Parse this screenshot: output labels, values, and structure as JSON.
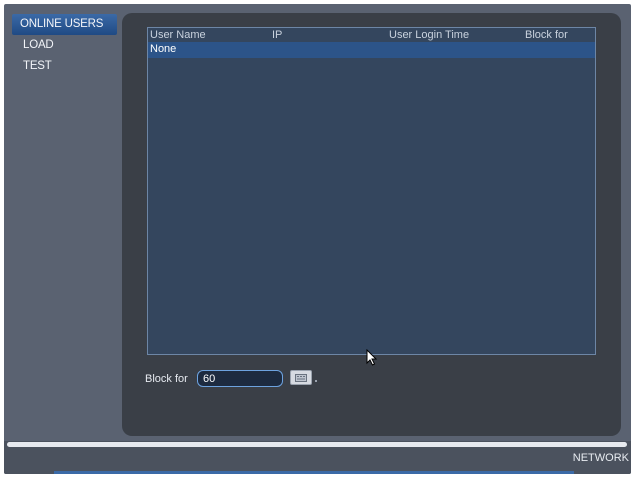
{
  "sidebar": {
    "items": [
      {
        "label": "ONLINE USERS",
        "active": true
      },
      {
        "label": "LOAD",
        "active": false
      },
      {
        "label": "TEST",
        "active": false
      }
    ]
  },
  "table": {
    "columns": [
      "User Name",
      "IP",
      "User Login Time",
      "Block for"
    ],
    "rows": [
      [
        "None",
        "",
        "",
        ""
      ]
    ]
  },
  "block": {
    "label": "Block for",
    "value": "60",
    "button_icon": "block-icon"
  },
  "status": {
    "section": "NETWORK"
  },
  "colors": {
    "active_item": "#2c5489",
    "panel": "#3a3f47",
    "table_bg": "#34465e"
  }
}
